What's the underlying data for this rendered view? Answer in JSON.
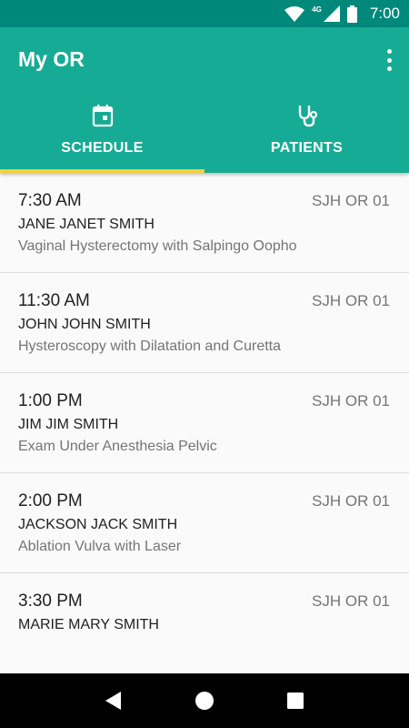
{
  "status_bar": {
    "time": "7:00",
    "network": "4G",
    "icons": [
      "wifi-icon",
      "cell-signal-icon",
      "battery-icon"
    ]
  },
  "app_bar": {
    "title": "My OR",
    "menu_icon": "more-vert-icon"
  },
  "tabs": [
    {
      "label": "SCHEDULE",
      "icon": "calendar-icon",
      "selected": true
    },
    {
      "label": "PATIENTS",
      "icon": "stethoscope-icon",
      "selected": false
    }
  ],
  "colors": {
    "status_bar": "#00897b",
    "app_bar": "#16ab94",
    "tab_indicator": "#f4d03f",
    "primary_text": "#212121",
    "secondary_text": "#757575"
  },
  "schedule": [
    {
      "time": "7:30 AM",
      "room": "SJH OR 01",
      "patient": "JANE JANET SMITH",
      "procedure": "Vaginal Hysterectomy with Salpingo Oopho"
    },
    {
      "time": "11:30 AM",
      "room": "SJH OR 01",
      "patient": "JOHN JOHN SMITH",
      "procedure": "Hysteroscopy with Dilatation and Curetta"
    },
    {
      "time": "1:00 PM",
      "room": "SJH OR 01",
      "patient": "JIM JIM SMITH",
      "procedure": "Exam Under Anesthesia Pelvic"
    },
    {
      "time": "2:00 PM",
      "room": "SJH OR 01",
      "patient": "JACKSON JACK SMITH",
      "procedure": "Ablation Vulva with Laser"
    },
    {
      "time": "3:30 PM",
      "room": "SJH OR 01",
      "patient": "MARIE MARY SMITH",
      "procedure": ""
    }
  ],
  "nav_bar": {
    "buttons": [
      "back-icon",
      "home-icon",
      "recents-icon"
    ]
  }
}
